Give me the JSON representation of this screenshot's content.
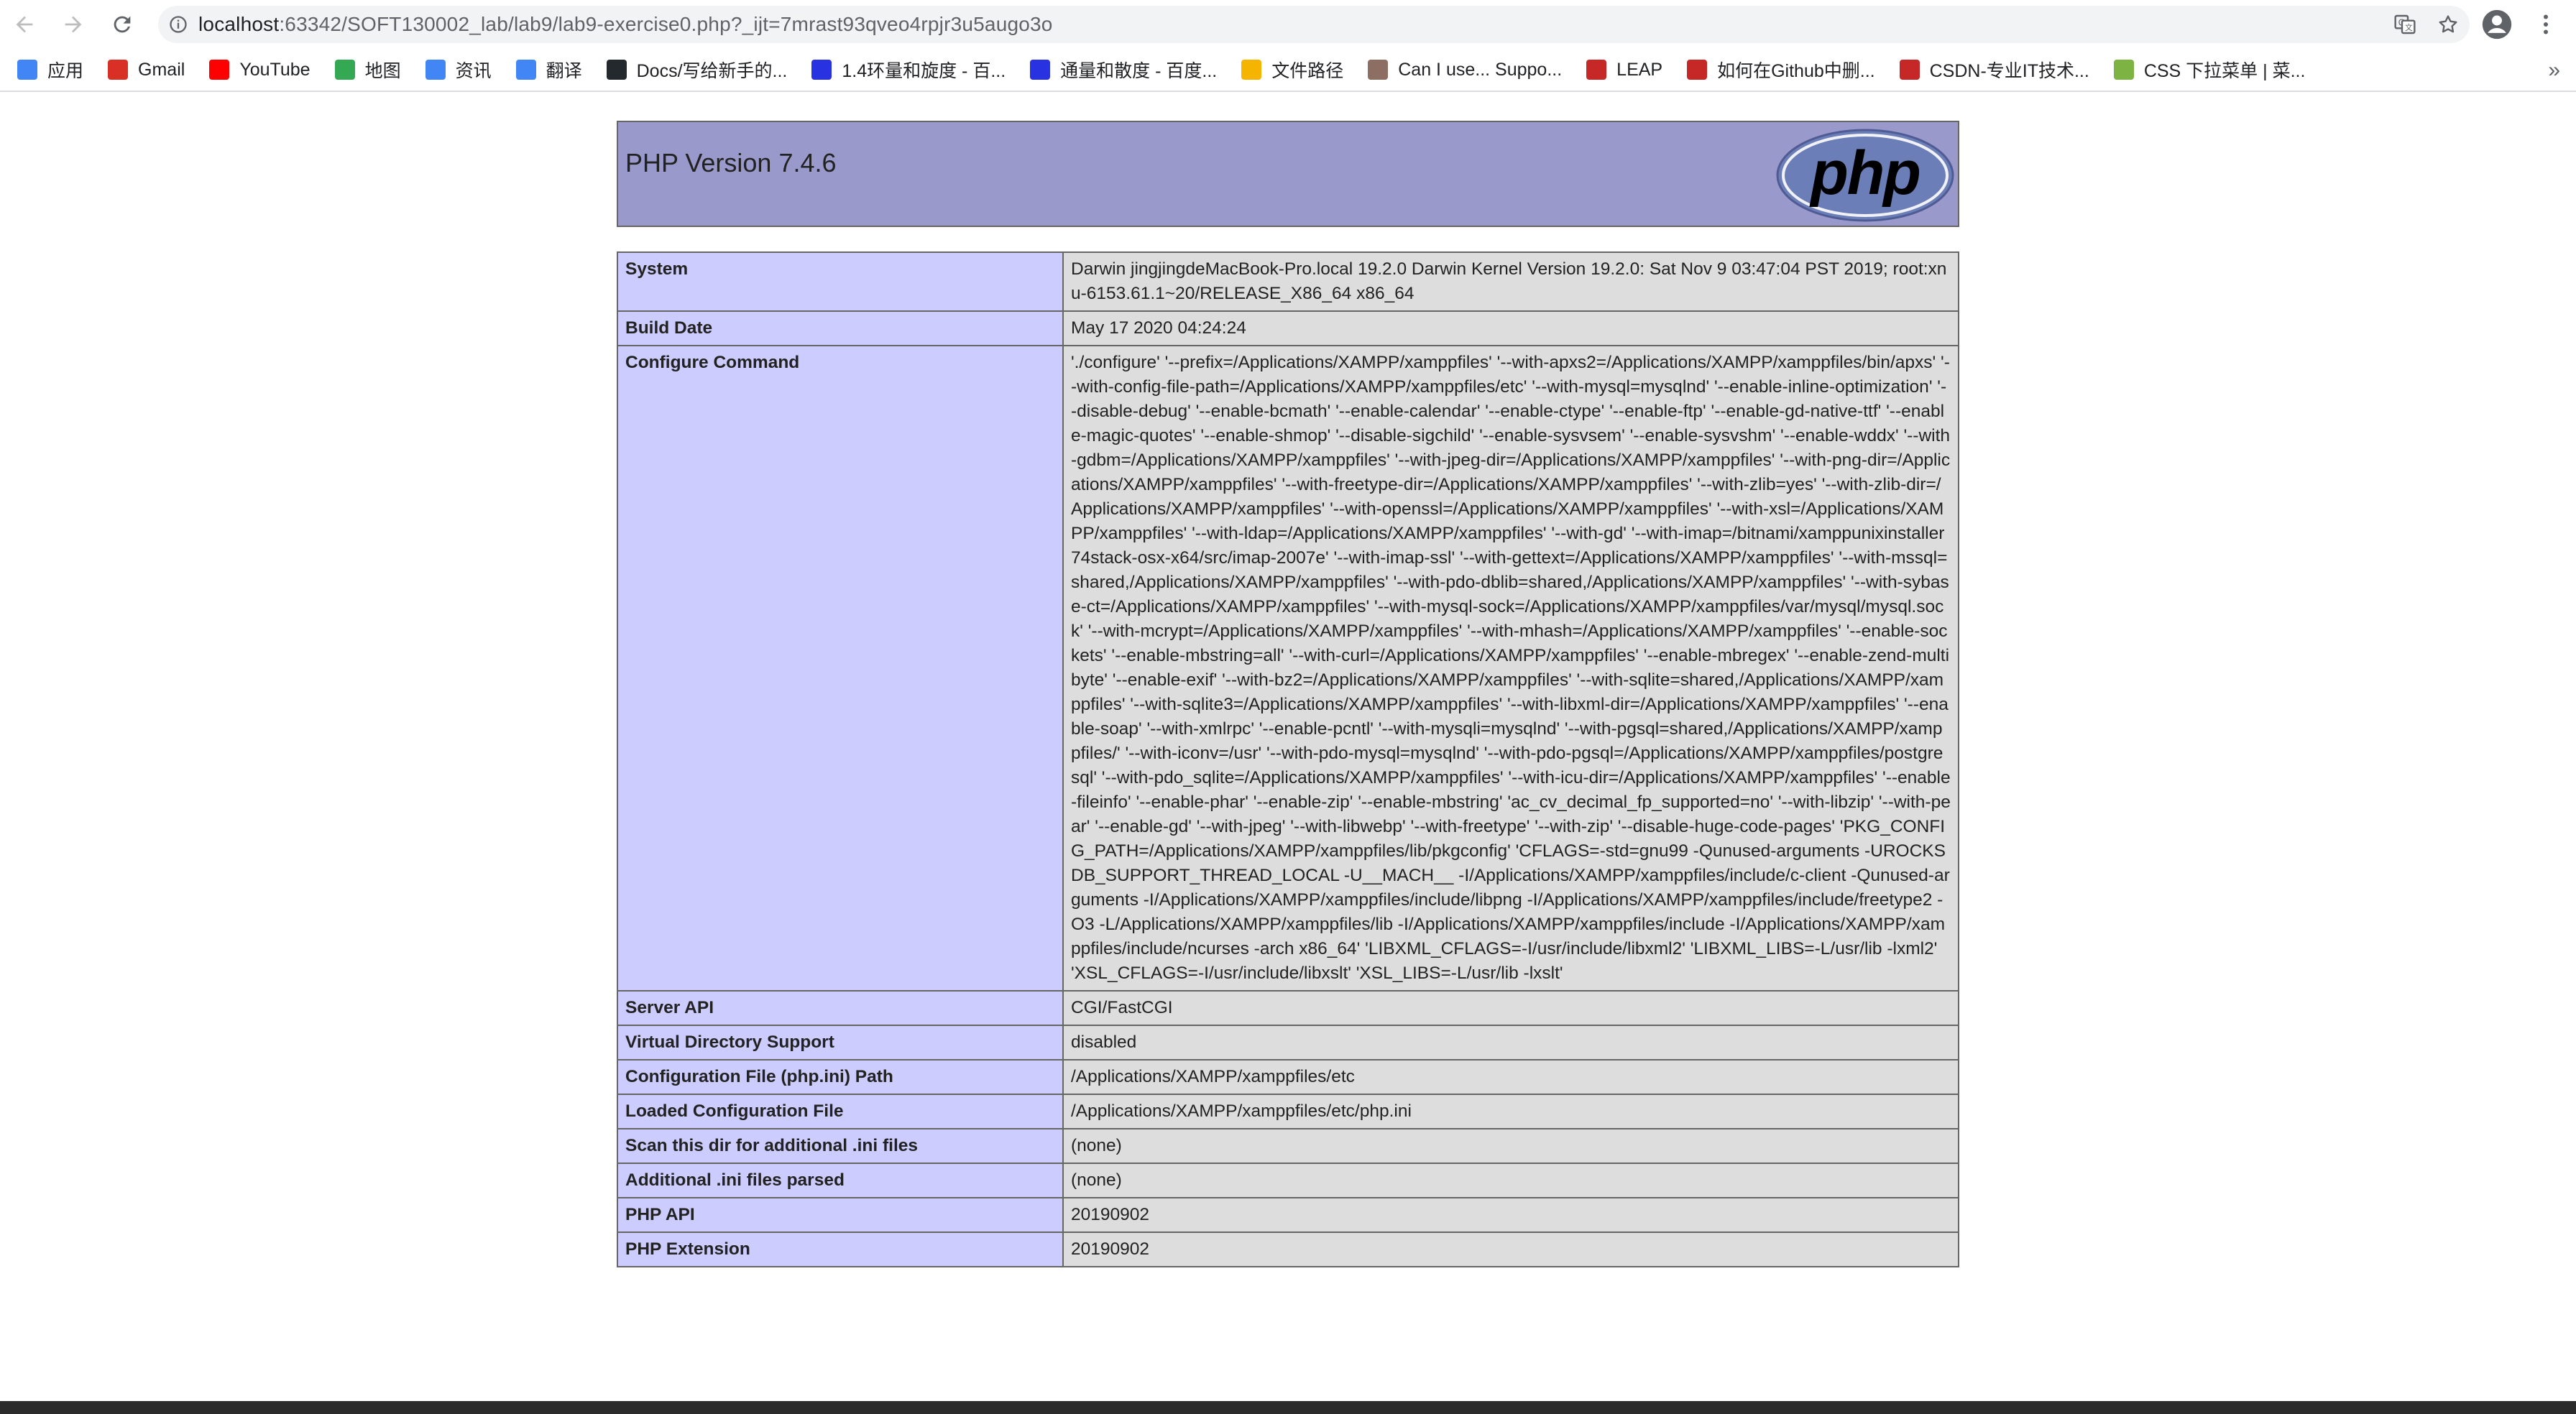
{
  "browser": {
    "url_host": "localhost",
    "url_rest": ":63342/SOFT130002_lab/lab9/lab9-exercise0.php?_ijt=7mrast93qveo4rpjr3u5augo3o",
    "bookmarks": [
      {
        "label": "应用",
        "icon": "apps-grid-icon",
        "color": "#4285f4"
      },
      {
        "label": "Gmail",
        "icon": "gmail-icon",
        "color": "#d93025"
      },
      {
        "label": "YouTube",
        "icon": "youtube-icon",
        "color": "#ff0000"
      },
      {
        "label": "地图",
        "icon": "maps-icon",
        "color": "#34a853"
      },
      {
        "label": "资讯",
        "icon": "news-icon",
        "color": "#4285f4"
      },
      {
        "label": "翻译",
        "icon": "translate-icon",
        "color": "#4285f4"
      },
      {
        "label": "Docs/写给新手的...",
        "icon": "github-icon",
        "color": "#24292e"
      },
      {
        "label": "1.4环量和旋度 - 百...",
        "icon": "baidu-icon",
        "color": "#2932e1"
      },
      {
        "label": "通量和散度 - 百度...",
        "icon": "baidu-icon",
        "color": "#2932e1"
      },
      {
        "label": "文件路径",
        "icon": "page-icon",
        "color": "#f4b400"
      },
      {
        "label": "Can I use... Suppo...",
        "icon": "caniuse-icon",
        "color": "#8d6e63"
      },
      {
        "label": "LEAP",
        "icon": "leap-icon",
        "color": "#c62828"
      },
      {
        "label": "如何在Github中删...",
        "icon": "csdn-icon",
        "color": "#c62828"
      },
      {
        "label": "CSDN-专业IT技术...",
        "icon": "csdn-icon",
        "color": "#c62828"
      },
      {
        "label": "CSS 下拉菜单 | 菜...",
        "icon": "runoob-icon",
        "color": "#7cb342"
      }
    ],
    "more_label": "»"
  },
  "php": {
    "title": "PHP Version 7.4.6",
    "logo_text": "php",
    "rows": [
      {
        "key": "System",
        "value": "Darwin jingjingdeMacBook-Pro.local 19.2.0 Darwin Kernel Version 19.2.0: Sat Nov 9 03:47:04 PST 2019; root:xnu-6153.61.1~20/RELEASE_X86_64 x86_64"
      },
      {
        "key": "Build Date",
        "value": "May 17 2020 04:24:24"
      },
      {
        "key": "Configure Command",
        "value": "'./configure' '--prefix=/Applications/XAMPP/xamppfiles' '--with-apxs2=/Applications/XAMPP/xamppfiles/bin/apxs' '--with-config-file-path=/Applications/XAMPP/xamppfiles/etc' '--with-mysql=mysqlnd' '--enable-inline-optimization' '--disable-debug' '--enable-bcmath' '--enable-calendar' '--enable-ctype' '--enable-ftp' '--enable-gd-native-ttf' '--enable-magic-quotes' '--enable-shmop' '--disable-sigchild' '--enable-sysvsem' '--enable-sysvshm' '--enable-wddx' '--with-gdbm=/Applications/XAMPP/xamppfiles' '--with-jpeg-dir=/Applications/XAMPP/xamppfiles' '--with-png-dir=/Applications/XAMPP/xamppfiles' '--with-freetype-dir=/Applications/XAMPP/xamppfiles' '--with-zlib=yes' '--with-zlib-dir=/Applications/XAMPP/xamppfiles' '--with-openssl=/Applications/XAMPP/xamppfiles' '--with-xsl=/Applications/XAMPP/xamppfiles' '--with-ldap=/Applications/XAMPP/xamppfiles' '--with-gd' '--with-imap=/bitnami/xamppunixinstaller74stack-osx-x64/src/imap-2007e' '--with-imap-ssl' '--with-gettext=/Applications/XAMPP/xamppfiles' '--with-mssql=shared,/Applications/XAMPP/xamppfiles' '--with-pdo-dblib=shared,/Applications/XAMPP/xamppfiles' '--with-sybase-ct=/Applications/XAMPP/xamppfiles' '--with-mysql-sock=/Applications/XAMPP/xamppfiles/var/mysql/mysql.sock' '--with-mcrypt=/Applications/XAMPP/xamppfiles' '--with-mhash=/Applications/XAMPP/xamppfiles' '--enable-sockets' '--enable-mbstring=all' '--with-curl=/Applications/XAMPP/xamppfiles' '--enable-mbregex' '--enable-zend-multibyte' '--enable-exif' '--with-bz2=/Applications/XAMPP/xamppfiles' '--with-sqlite=shared,/Applications/XAMPP/xamppfiles' '--with-sqlite3=/Applications/XAMPP/xamppfiles' '--with-libxml-dir=/Applications/XAMPP/xamppfiles' '--enable-soap' '--with-xmlrpc' '--enable-pcntl' '--with-mysqli=mysqlnd' '--with-pgsql=shared,/Applications/XAMPP/xamppfiles/' '--with-iconv=/usr' '--with-pdo-mysql=mysqlnd' '--with-pdo-pgsql=/Applications/XAMPP/xamppfiles/postgresql' '--with-pdo_sqlite=/Applications/XAMPP/xamppfiles' '--with-icu-dir=/Applications/XAMPP/xamppfiles' '--enable-fileinfo' '--enable-phar' '--enable-zip' '--enable-mbstring' 'ac_cv_decimal_fp_supported=no' '--with-libzip' '--with-pear' '--enable-gd' '--with-jpeg' '--with-libwebp' '--with-freetype' '--with-zip' '--disable-huge-code-pages' 'PKG_CONFIG_PATH=/Applications/XAMPP/xamppfiles/lib/pkgconfig' 'CFLAGS=-std=gnu99 -Qunused-arguments -UROCKSDB_SUPPORT_THREAD_LOCAL -U__MACH__ -I/Applications/XAMPP/xamppfiles/include/c-client -Qunused-arguments -I/Applications/XAMPP/xamppfiles/include/libpng -I/Applications/XAMPP/xamppfiles/include/freetype2 -O3 -L/Applications/XAMPP/xamppfiles/lib -I/Applications/XAMPP/xamppfiles/include -I/Applications/XAMPP/xamppfiles/include/ncurses -arch x86_64' 'LIBXML_CFLAGS=-I/usr/include/libxml2' 'LIBXML_LIBS=-L/usr/lib -lxml2' 'XSL_CFLAGS=-I/usr/include/libxslt' 'XSL_LIBS=-L/usr/lib -lxslt'"
      },
      {
        "key": "Server API",
        "value": "CGI/FastCGI"
      },
      {
        "key": "Virtual Directory Support",
        "value": "disabled"
      },
      {
        "key": "Configuration File (php.ini) Path",
        "value": "/Applications/XAMPP/xamppfiles/etc"
      },
      {
        "key": "Loaded Configuration File",
        "value": "/Applications/XAMPP/xamppfiles/etc/php.ini"
      },
      {
        "key": "Scan this dir for additional .ini files",
        "value": "(none)"
      },
      {
        "key": "Additional .ini files parsed",
        "value": "(none)"
      },
      {
        "key": "PHP API",
        "value": "20190902"
      },
      {
        "key": "PHP Extension",
        "value": "20190902"
      }
    ]
  },
  "colors": {
    "header_bg": "#9999cc",
    "key_bg": "#ccccff",
    "value_bg": "#dddddd",
    "border": "#666666"
  }
}
